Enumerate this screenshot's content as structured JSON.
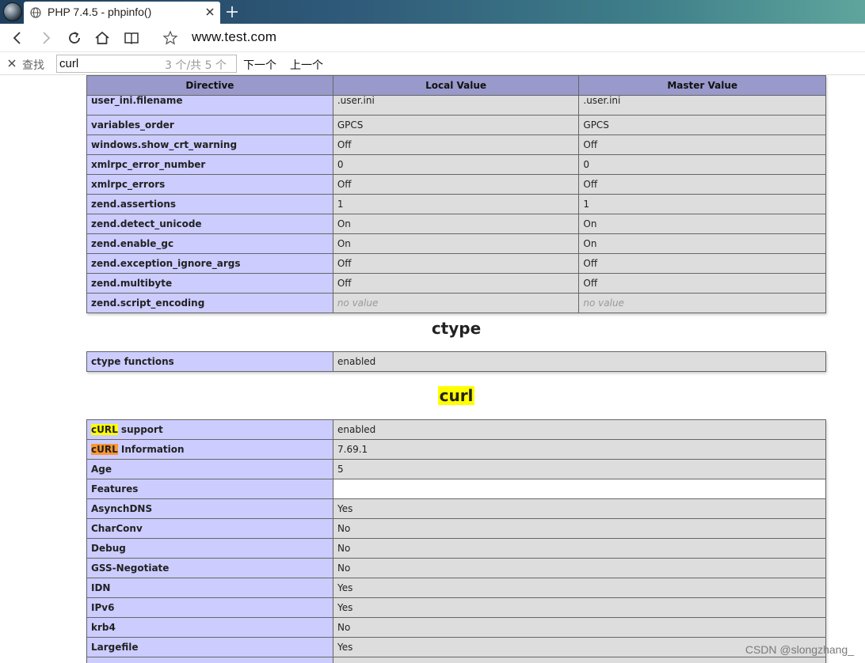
{
  "browser": {
    "tab_title": "PHP 7.4.5 - phpinfo()",
    "url": "www.test.com",
    "find": {
      "label": "查找",
      "query": "curl",
      "count": "3 个/共 5 个",
      "next": "下一个",
      "prev": "上一个"
    }
  },
  "core_table": {
    "headers": [
      "Directive",
      "Local Value",
      "Master Value"
    ],
    "rows": [
      {
        "directive": "user_ini.filename",
        "local": ".user.ini",
        "master": ".user.ini"
      },
      {
        "directive": "variables_order",
        "local": "GPCS",
        "master": "GPCS"
      },
      {
        "directive": "windows.show_crt_warning",
        "local": "Off",
        "master": "Off"
      },
      {
        "directive": "xmlrpc_error_number",
        "local": "0",
        "master": "0"
      },
      {
        "directive": "xmlrpc_errors",
        "local": "Off",
        "master": "Off"
      },
      {
        "directive": "zend.assertions",
        "local": "1",
        "master": "1"
      },
      {
        "directive": "zend.detect_unicode",
        "local": "On",
        "master": "On"
      },
      {
        "directive": "zend.enable_gc",
        "local": "On",
        "master": "On"
      },
      {
        "directive": "zend.exception_ignore_args",
        "local": "Off",
        "master": "Off"
      },
      {
        "directive": "zend.multibyte",
        "local": "Off",
        "master": "Off"
      },
      {
        "directive": "zend.script_encoding",
        "local": "no value",
        "master": "no value"
      }
    ]
  },
  "ctype": {
    "title": "ctype",
    "rows": [
      {
        "name": "ctype functions",
        "value": "enabled"
      }
    ]
  },
  "curl": {
    "title": "curl",
    "rows": [
      {
        "name_hl": "cURL",
        "name_rest": " support",
        "value": "enabled"
      },
      {
        "name_hl": "cURL",
        "name_rest": " Information",
        "value": "7.69.1"
      },
      {
        "name": "Age",
        "value": "5"
      },
      {
        "name": "Features",
        "value": ""
      },
      {
        "name": "AsynchDNS",
        "value": "Yes"
      },
      {
        "name": "CharConv",
        "value": "No"
      },
      {
        "name": "Debug",
        "value": "No"
      },
      {
        "name": "GSS-Negotiate",
        "value": "No"
      },
      {
        "name": "IDN",
        "value": "Yes"
      },
      {
        "name": "IPv6",
        "value": "Yes"
      },
      {
        "name": "krb4",
        "value": "No"
      },
      {
        "name": "Largefile",
        "value": "Yes"
      }
    ]
  },
  "watermark": "CSDN @slongzhang_",
  "colors": {
    "header": "#9999cc",
    "directive_cell": "#ccccff",
    "value_cell": "#dddddd",
    "highlight_match": "#ffff00",
    "highlight_current": "#ff9632"
  }
}
